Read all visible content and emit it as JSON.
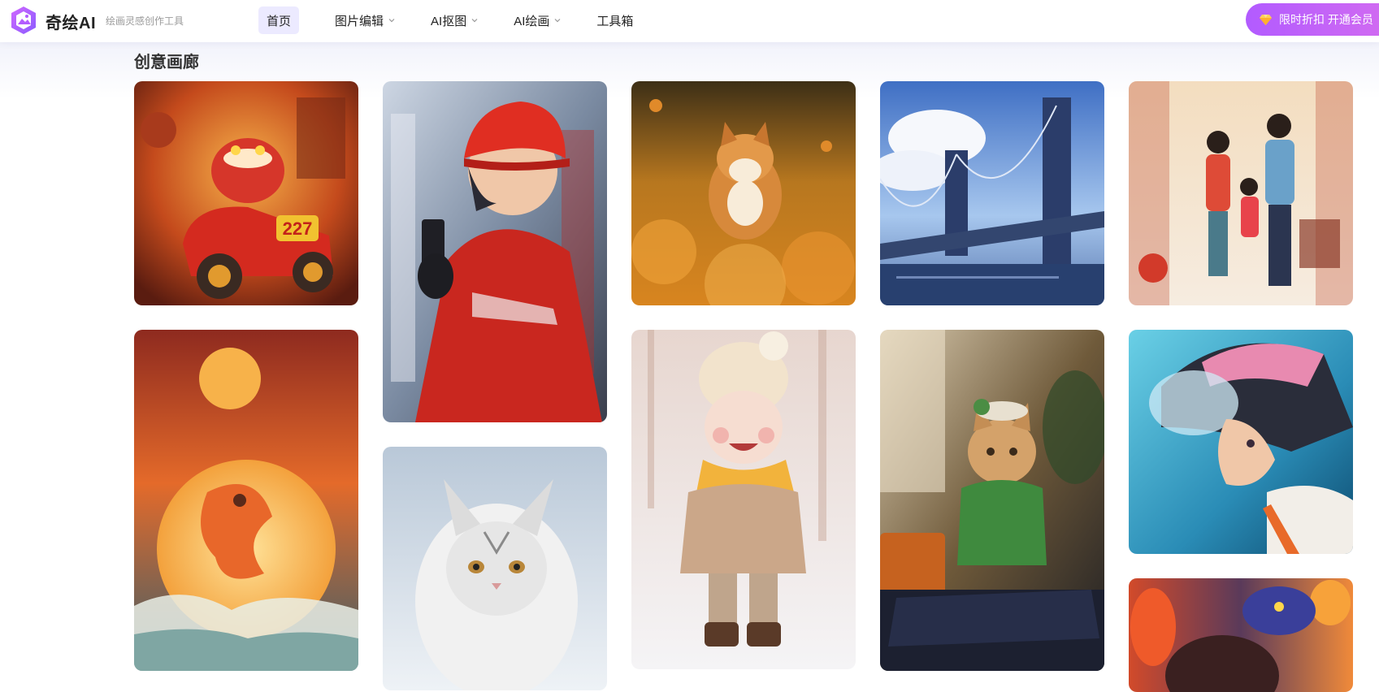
{
  "header": {
    "logo_icon": "qihui-logo-icon",
    "brand": "奇绘AI",
    "tagline": "绘画灵感创作工具",
    "nav": [
      {
        "label": "首页",
        "active": true,
        "dropdown": false
      },
      {
        "label": "图片编辑",
        "active": false,
        "dropdown": true
      },
      {
        "label": "AI抠图",
        "active": false,
        "dropdown": true
      },
      {
        "label": "AI绘画",
        "active": false,
        "dropdown": true
      },
      {
        "label": "工具箱",
        "active": false,
        "dropdown": false
      }
    ],
    "vip_button": {
      "label": "限时折扣 开通会员",
      "icon": "gem-icon"
    }
  },
  "gallery": {
    "title": "创意画廊",
    "items": [
      {
        "subject": "red dragon driving car",
        "badge": "227"
      },
      {
        "subject": "boy in red jacket"
      },
      {
        "subject": "shiba inu in autumn leaves"
      },
      {
        "subject": "suspension bridge at dusk"
      },
      {
        "subject": "family shopping in market"
      },
      {
        "subject": "dragon and sun"
      },
      {
        "subject": "white fluffy kitten"
      },
      {
        "subject": "girl in snow"
      },
      {
        "subject": "cat in green sweater"
      },
      {
        "subject": "girl with helmet"
      },
      {
        "subject": "lanterns and dragon"
      }
    ]
  },
  "colors": {
    "accent": "#b25bff",
    "nav_active_bg": "#eceaff"
  }
}
